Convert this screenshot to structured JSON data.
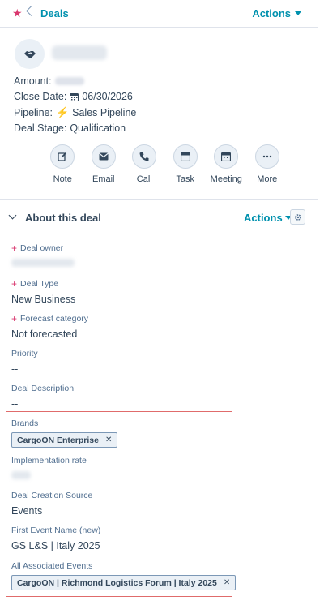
{
  "header": {
    "breadcrumb": "Deals",
    "actions_label": "Actions"
  },
  "deal": {
    "amount_label": "Amount:",
    "close_date_label": "Close Date:",
    "close_date_value": "06/30/2026",
    "pipeline_label": "Pipeline:",
    "pipeline_value": "Sales Pipeline",
    "stage_label": "Deal Stage:",
    "stage_value": "Qualification"
  },
  "quick_actions": [
    {
      "label": "Note",
      "icon": "pencil-icon"
    },
    {
      "label": "Email",
      "icon": "envelope-icon"
    },
    {
      "label": "Call",
      "icon": "phone-icon"
    },
    {
      "label": "Task",
      "icon": "task-icon"
    },
    {
      "label": "Meeting",
      "icon": "calendar-icon"
    },
    {
      "label": "More",
      "icon": "more-icon"
    }
  ],
  "about": {
    "title": "About this deal",
    "actions_label": "Actions",
    "fields": {
      "deal_owner_label": "Deal owner",
      "deal_type_label": "Deal Type",
      "deal_type_value": "New Business",
      "forecast_label": "Forecast category",
      "forecast_value": "Not forecasted",
      "priority_label": "Priority",
      "priority_value": "--",
      "description_label": "Deal Description",
      "description_value": "--",
      "brands_label": "Brands",
      "brands_tag": "CargoON Enterprise",
      "implementation_label": "Implementation rate",
      "source_label": "Deal Creation Source",
      "source_value": "Events",
      "first_event_label": "First Event Name (new)",
      "first_event_value": "GS L&S | Italy 2025",
      "assoc_events_label": "All Associated Events",
      "assoc_events_tag": "CargoON | Richmond Logistics Forum | Italy 2025"
    }
  },
  "colors": {
    "accent": "#0091ae",
    "brand": "#d9376e",
    "text": "#33475b",
    "highlight": "#e06b6b"
  }
}
